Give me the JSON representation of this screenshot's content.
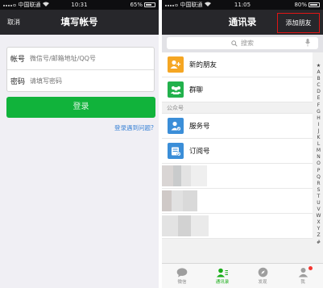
{
  "left": {
    "statusbar": {
      "carrier": "中国联通",
      "time": "10:31",
      "battery": "65%"
    },
    "nav": {
      "cancel": "取消",
      "title": "填写帐号"
    },
    "form": {
      "account_label": "帐号",
      "account_placeholder": "微信号/邮箱地址/QQ号",
      "password_label": "密码",
      "password_placeholder": "请填写密码"
    },
    "login_button": "登录",
    "help_link": "登录遇到问题?"
  },
  "right": {
    "statusbar": {
      "carrier": "中国联通",
      "time": "11:05",
      "battery": "80%"
    },
    "nav": {
      "title": "通讯录",
      "add_friend": "添加朋友"
    },
    "search": {
      "placeholder": "搜索"
    },
    "rows": [
      {
        "label": "新的朋友",
        "icon": "add-friend-icon",
        "color": "#f5a623"
      },
      {
        "label": "群聊",
        "icon": "group-chat-icon",
        "color": "#22b14c"
      }
    ],
    "section_title": "公众号",
    "official_rows": [
      {
        "label": "服务号",
        "icon": "service-account-icon",
        "color": "#3b8ed8"
      },
      {
        "label": "订阅号",
        "icon": "subscription-icon",
        "color": "#3b8ed8"
      }
    ],
    "index_letters": [
      "★",
      "A",
      "B",
      "C",
      "D",
      "E",
      "F",
      "G",
      "H",
      "I",
      "J",
      "K",
      "L",
      "M",
      "N",
      "O",
      "P",
      "Q",
      "R",
      "S",
      "T",
      "U",
      "V",
      "W",
      "X",
      "Y",
      "Z",
      "#"
    ],
    "tabs": [
      {
        "label": "微信",
        "icon": "chat-bubble-icon",
        "active": false
      },
      {
        "label": "通讯录",
        "icon": "contacts-icon",
        "active": true
      },
      {
        "label": "发现",
        "icon": "compass-icon",
        "active": false
      },
      {
        "label": "我",
        "icon": "me-icon",
        "active": false
      }
    ]
  }
}
